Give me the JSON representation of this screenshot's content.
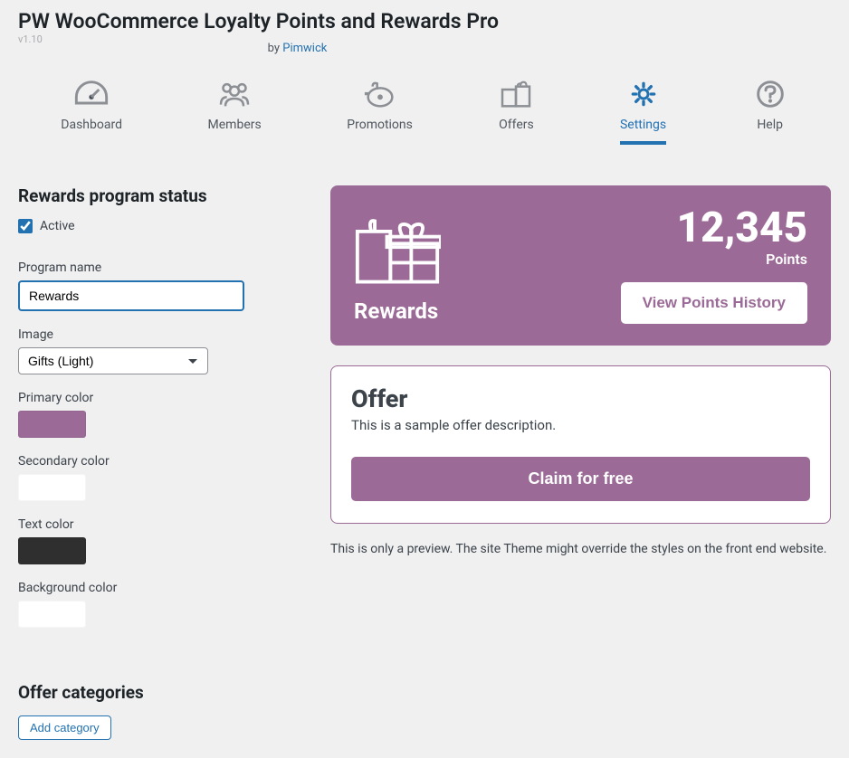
{
  "header": {
    "title": "PW WooCommerce Loyalty Points and Rewards Pro",
    "version": "v1.10",
    "by_prefix": "by ",
    "by_link": "Pimwick"
  },
  "tabs": [
    {
      "id": "dashboard",
      "label": "Dashboard"
    },
    {
      "id": "members",
      "label": "Members"
    },
    {
      "id": "promotions",
      "label": "Promotions"
    },
    {
      "id": "offers",
      "label": "Offers"
    },
    {
      "id": "settings",
      "label": "Settings"
    },
    {
      "id": "help",
      "label": "Help"
    }
  ],
  "section_status_title": "Rewards program status",
  "active_checkbox": {
    "checked": true,
    "label": "Active"
  },
  "fields": {
    "program_name": {
      "label": "Program name",
      "value": "Rewards"
    },
    "image": {
      "label": "Image",
      "value": "Gifts (Light)"
    },
    "primary_color": {
      "label": "Primary color",
      "value": "#9b6a97"
    },
    "secondary_color": {
      "label": "Secondary color",
      "value": "#ffffff"
    },
    "text_color": {
      "label": "Text color",
      "value": "#2f2f2f"
    },
    "background_color": {
      "label": "Background color",
      "value": "#ffffff"
    }
  },
  "preview": {
    "points_value": "12,345",
    "points_label": "Points",
    "card_title": "Rewards",
    "history_btn": "View Points History",
    "offer_title": "Offer",
    "offer_desc": "This is a sample offer description.",
    "claim_btn": "Claim for free",
    "note": "This is only a preview. The site Theme might override the styles on the front end website."
  },
  "offer_categories": {
    "title": "Offer categories",
    "add_btn": "Add category"
  }
}
